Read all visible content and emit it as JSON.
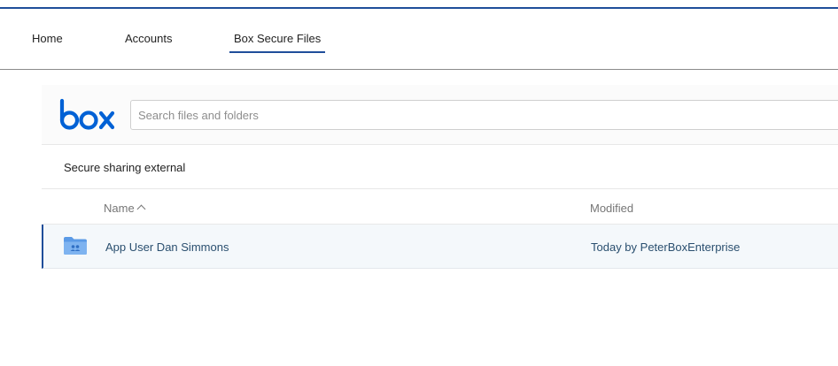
{
  "nav": {
    "items": [
      {
        "label": "Home"
      },
      {
        "label": "Accounts"
      },
      {
        "label": "Box Secure Files"
      }
    ],
    "active": "Box Secure Files"
  },
  "box": {
    "logo": "box",
    "brand_color": "#0061d5",
    "search": {
      "placeholder": "Search files and folders",
      "value": ""
    },
    "breadcrumb": "Secure sharing external",
    "columns": {
      "name": "Name",
      "modified": "Modified"
    },
    "sort": {
      "column": "Name",
      "direction": "ascending"
    },
    "files": [
      {
        "name": "App User Dan Simmons",
        "modified": "Today by PeterBoxEnterprise",
        "icon": "shared-folder-icon"
      }
    ]
  }
}
